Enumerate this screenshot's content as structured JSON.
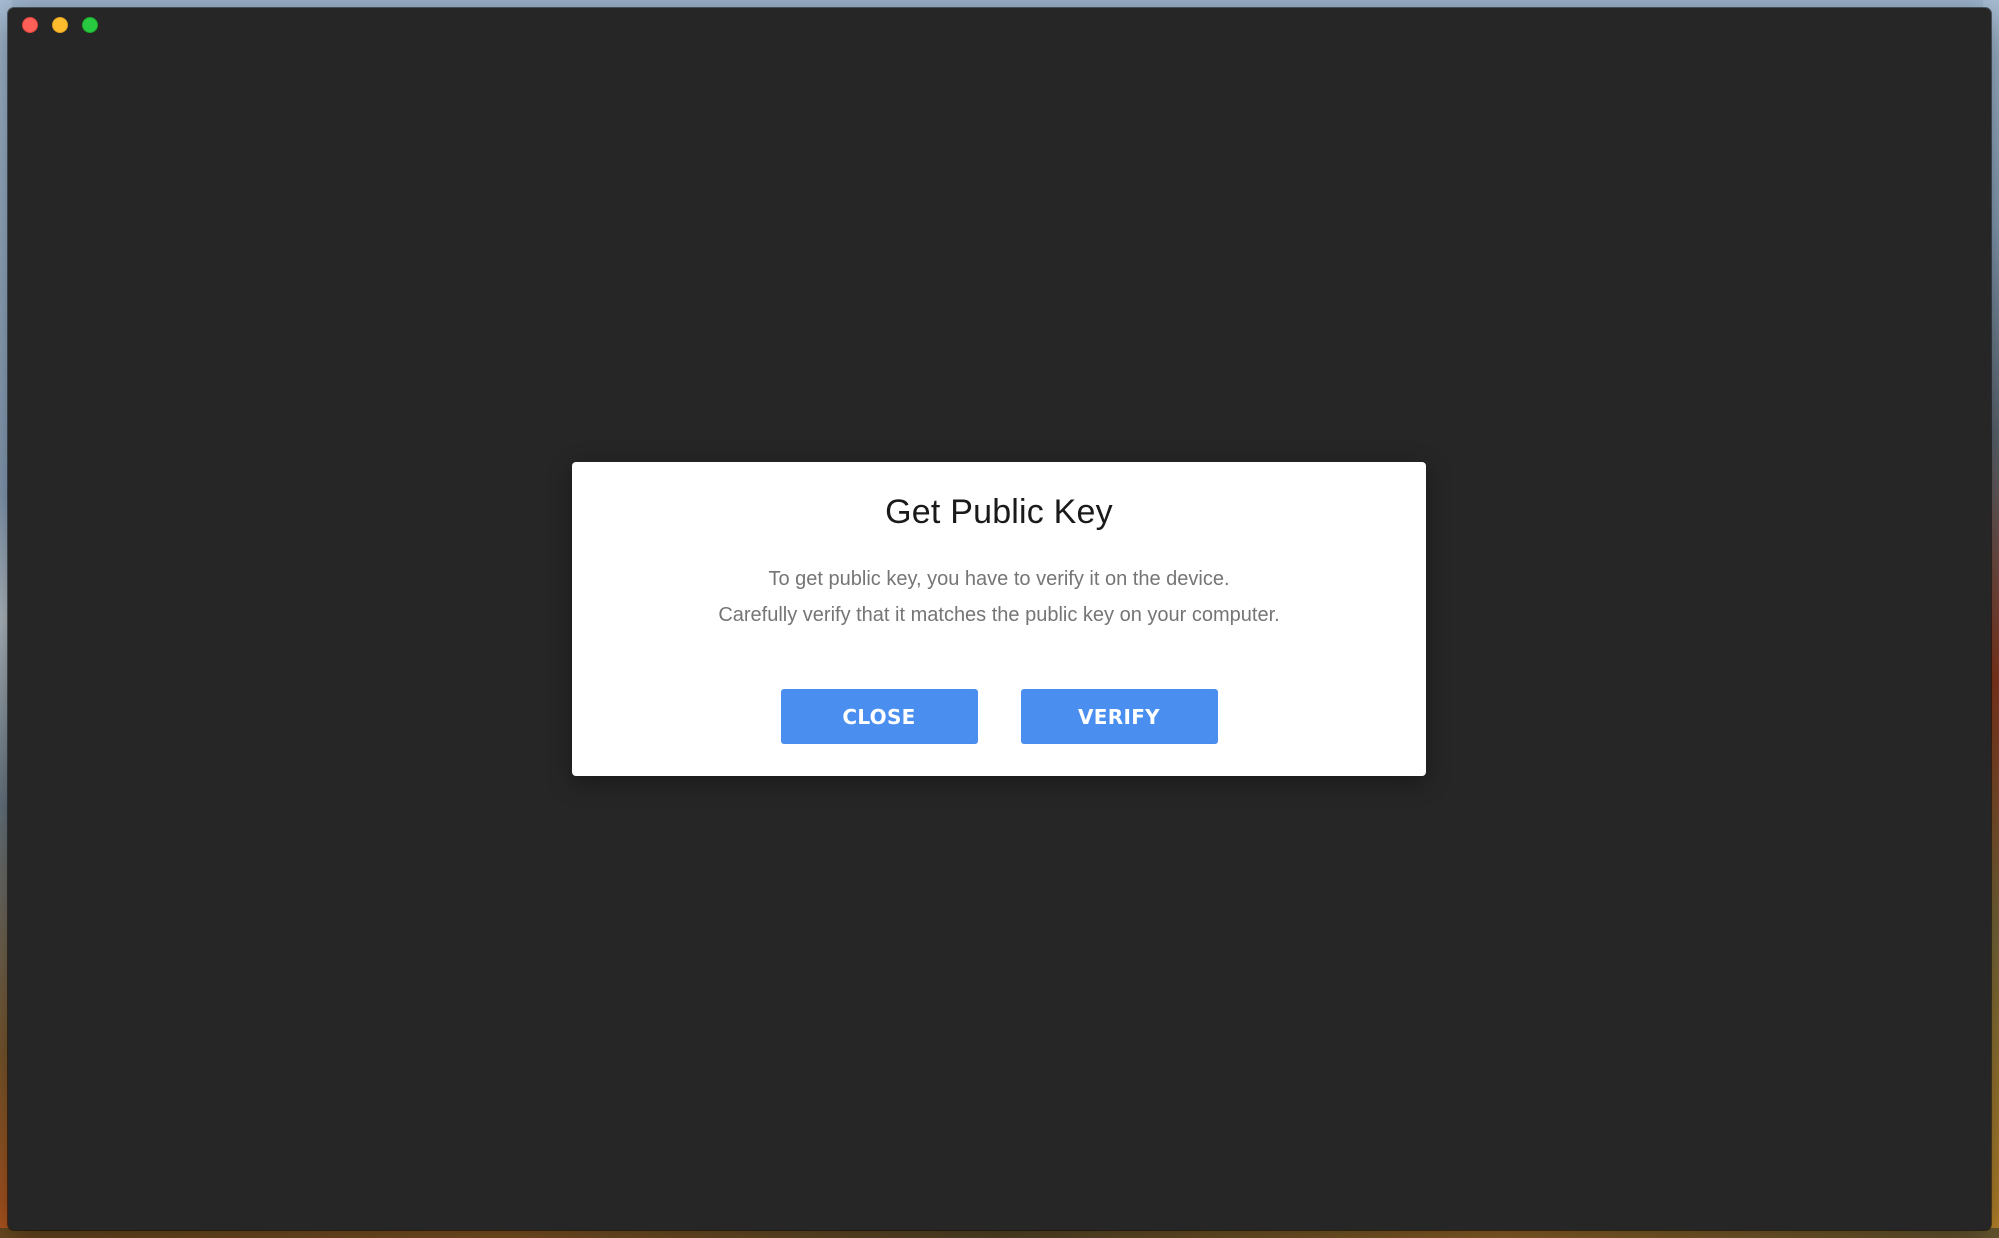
{
  "window": {
    "controls": {
      "close": "close-window",
      "minimize": "minimize-window",
      "maximize": "maximize-window"
    }
  },
  "dialog": {
    "title": "Get Public Key",
    "message_line1": "To get public key, you have to verify it on the device.",
    "message_line2": "Carefully verify that it matches the public key on your computer.",
    "close_label": "CLOSE",
    "verify_label": "VERIFY"
  },
  "colors": {
    "window_background": "#262626",
    "button_accent": "#4a8ff0",
    "dialog_background": "#ffffff",
    "traffic_close": "#fe5f57",
    "traffic_minimize": "#febc2e",
    "traffic_maximize": "#28c840"
  }
}
